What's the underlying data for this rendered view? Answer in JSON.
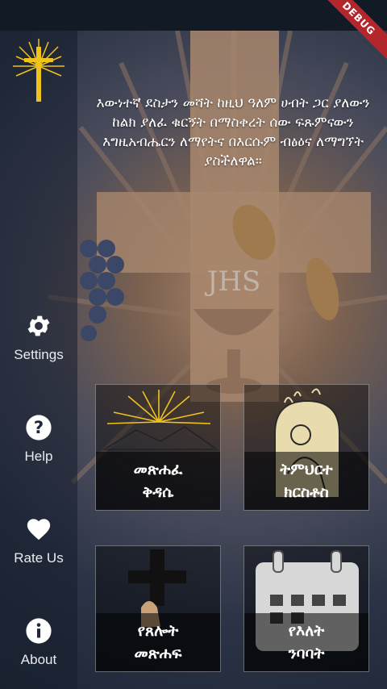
{
  "quote": "እውነተኛ ደስታን መሻት ከዚህ  ዓለም ሀብት ጋር ያለውን ከልክ ያለፈ ቁርኝት በማስቀረት ሰው ፍጹምናውን እግዚአብሔርን ለማየትና በእርሱም ብፅዕና ለማግኘት ያስችለዋል።",
  "background_monogram": "JHS",
  "debug_banner": "DEBUG",
  "sidebar": {
    "items": [
      {
        "label": "Settings",
        "icon": "gear-icon"
      },
      {
        "label": "Help",
        "icon": "help-icon"
      },
      {
        "label": "Rate Us",
        "icon": "heart-icon"
      },
      {
        "label": "About",
        "icon": "info-icon"
      }
    ]
  },
  "tiles": [
    {
      "label": "መጽሐፈ\nቅዳሴ",
      "icon": "sunrise-mountain-icon"
    },
    {
      "label": "ትምህርተ\nክርስቶስ",
      "icon": "saint-figure-icon"
    },
    {
      "label": "የጸሎት\nመጽሐፍ",
      "icon": "cross-praying-hands-icon"
    },
    {
      "label": "የእለት\nንባባት",
      "icon": "calendar-icon"
    }
  ],
  "colors": {
    "gold": "#f0c21c",
    "debug_red": "#b3262b",
    "sidebar_text": "#e8ecf1"
  }
}
